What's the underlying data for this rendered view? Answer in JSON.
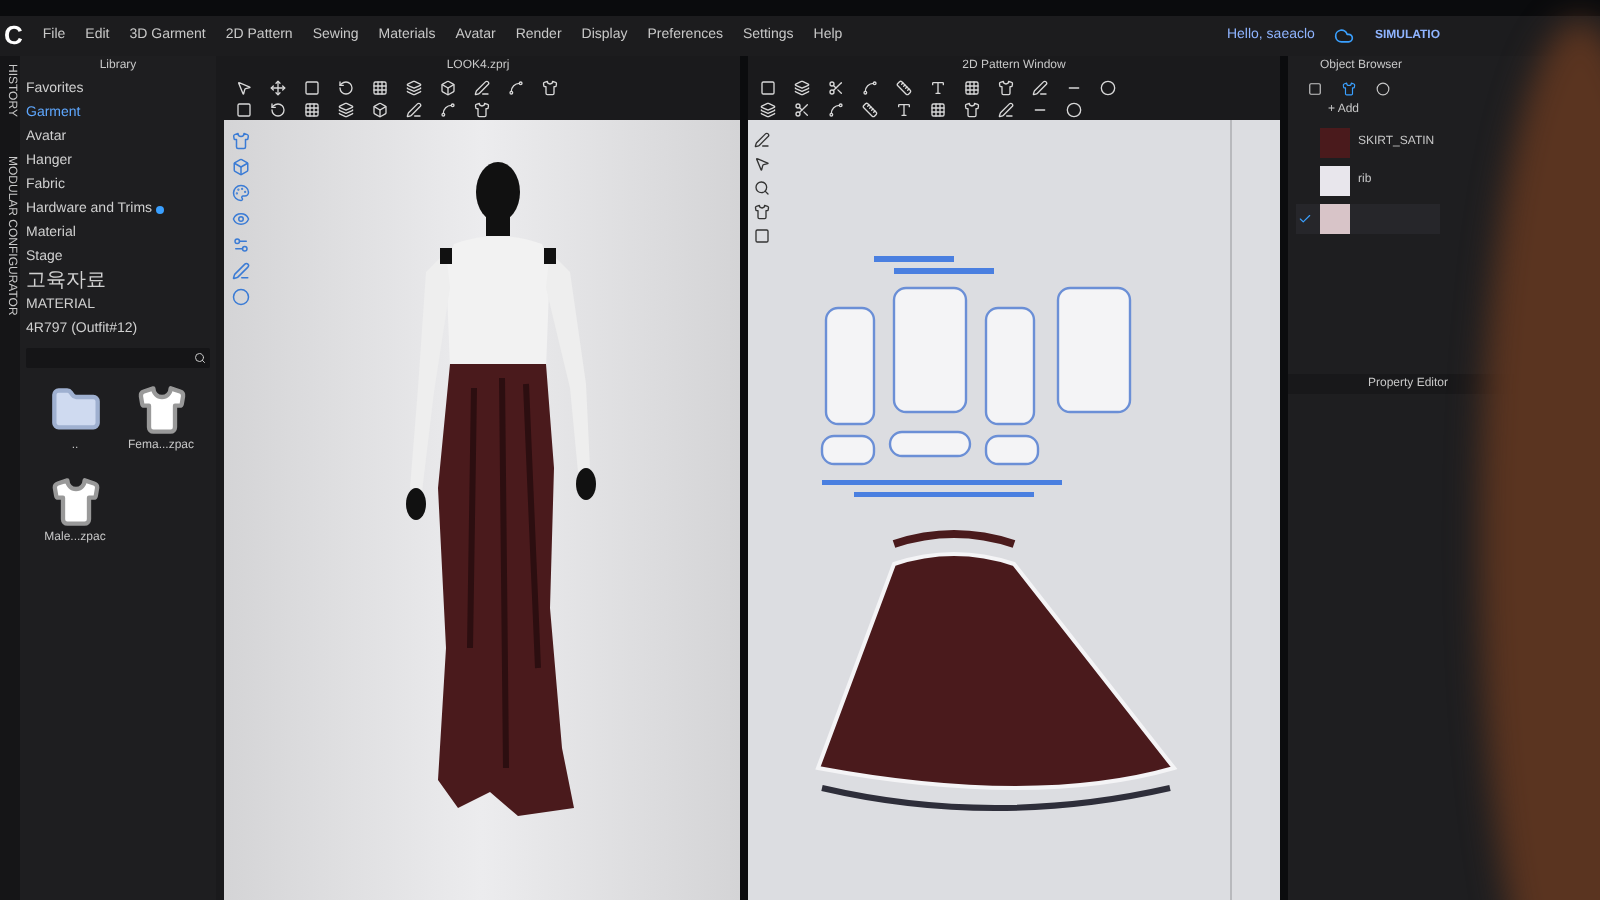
{
  "app": {
    "logo": "C",
    "menu": [
      "File",
      "Edit",
      "3D Garment",
      "2D Pattern",
      "Sewing",
      "Materials",
      "Avatar",
      "Render",
      "Display",
      "Preferences",
      "Settings",
      "Help"
    ],
    "user": "Hello, saeaclo",
    "mode_button": "SIMULATIO"
  },
  "side_tabs": [
    "HISTORY",
    "MODULAR CONFIGURATOR"
  ],
  "library": {
    "title": "Library",
    "items": [
      {
        "label": "Favorites",
        "selected": false,
        "badge": false
      },
      {
        "label": "Garment",
        "selected": true,
        "badge": false
      },
      {
        "label": "Avatar",
        "selected": false,
        "badge": false
      },
      {
        "label": "Hanger",
        "selected": false,
        "badge": false
      },
      {
        "label": "Fabric",
        "selected": false,
        "badge": false
      },
      {
        "label": "Hardware and Trims",
        "selected": false,
        "badge": true
      },
      {
        "label": "Material",
        "selected": false,
        "badge": false
      },
      {
        "label": "Stage",
        "selected": false,
        "badge": false
      },
      {
        "label": "고육자료",
        "selected": false,
        "badge": false
      },
      {
        "label": "MATERIAL",
        "selected": false,
        "badge": false
      },
      {
        "label": "4R797 (Outfit#12)",
        "selected": false,
        "badge": false
      }
    ],
    "files": [
      {
        "label": "..",
        "kind": "folder"
      },
      {
        "label": "Fema...zpac",
        "kind": "garment"
      },
      {
        "label": "Male...zpac",
        "kind": "garment"
      }
    ]
  },
  "viewport_3d": {
    "title": "LOOK4.zprj"
  },
  "pattern_window": {
    "title": "2D Pattern Window"
  },
  "object_browser": {
    "title": "Object Browser",
    "add": "+ Add",
    "materials": [
      {
        "name": "SKIRT_SATIN",
        "color": "#4a1a1c",
        "selected": false
      },
      {
        "name": "rib",
        "color": "#e8e6ec",
        "selected": false
      },
      {
        "color": "#d8c4c8",
        "selected": true
      }
    ]
  },
  "property_editor": {
    "title": "Property Editor"
  }
}
